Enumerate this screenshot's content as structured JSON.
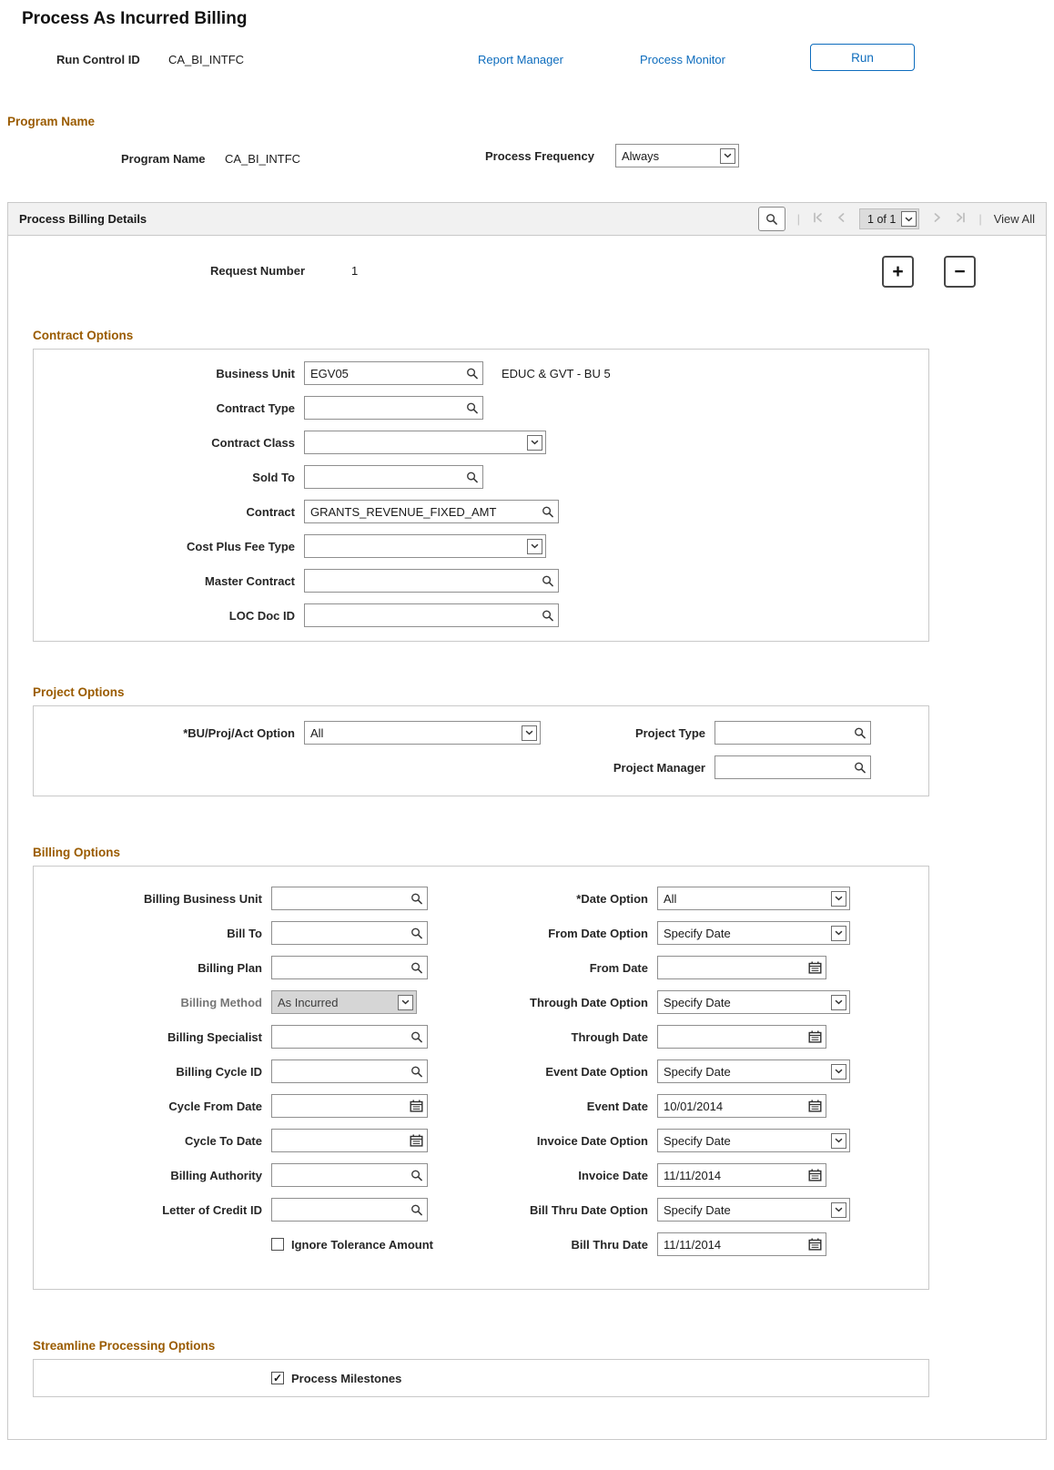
{
  "page_title": "Process As Incurred Billing",
  "toolbar": {
    "run_control_id_label": "Run Control ID",
    "run_control_id_value": "CA_BI_INTFC",
    "report_manager_link": "Report Manager",
    "process_monitor_link": "Process Monitor",
    "run_button_label": "Run"
  },
  "program_section": {
    "heading": "Program Name",
    "program_name_label": "Program Name",
    "program_name_value": "CA_BI_INTFC",
    "process_frequency_label": "Process Frequency",
    "process_frequency_value": "Always"
  },
  "process_billing_details": {
    "heading": "Process Billing Details",
    "row_counter": "1 of 1",
    "view_all_label": "View All",
    "request_number_label": "Request Number",
    "request_number_value": "1"
  },
  "icons": {
    "add_row": "+",
    "remove_row": "−"
  },
  "contract_options": {
    "heading": "Contract Options",
    "business_unit": {
      "label": "Business Unit",
      "value": "EGV05",
      "description": "EDUC & GVT - BU 5"
    },
    "contract_type": {
      "label": "Contract Type",
      "value": ""
    },
    "contract_class": {
      "label": "Contract Class",
      "value": ""
    },
    "sold_to": {
      "label": "Sold To",
      "value": ""
    },
    "contract": {
      "label": "Contract",
      "value": "GRANTS_REVENUE_FIXED_AMT"
    },
    "cost_plus_fee_type": {
      "label": "Cost Plus Fee Type",
      "value": ""
    },
    "master_contract": {
      "label": "Master Contract",
      "value": ""
    },
    "loc_doc_id": {
      "label": "LOC Doc ID",
      "value": ""
    }
  },
  "project_options": {
    "heading": "Project Options",
    "bu_proj_act_option": {
      "label": "*BU/Proj/Act Option",
      "value": "All"
    },
    "project_type": {
      "label": "Project Type",
      "value": ""
    },
    "project_manager": {
      "label": "Project Manager",
      "value": ""
    }
  },
  "billing_options": {
    "heading": "Billing Options",
    "billing_business_unit": {
      "label": "Billing Business Unit",
      "value": ""
    },
    "bill_to": {
      "label": "Bill To",
      "value": ""
    },
    "billing_plan": {
      "label": "Billing Plan",
      "value": ""
    },
    "billing_method": {
      "label": "Billing Method",
      "value": "As Incurred",
      "disabled": true
    },
    "billing_specialist": {
      "label": "Billing Specialist",
      "value": ""
    },
    "billing_cycle_id": {
      "label": "Billing Cycle ID",
      "value": ""
    },
    "cycle_from_date": {
      "label": "Cycle From Date",
      "value": ""
    },
    "cycle_to_date": {
      "label": "Cycle To Date",
      "value": ""
    },
    "billing_authority": {
      "label": "Billing Authority",
      "value": ""
    },
    "letter_of_credit_id": {
      "label": "Letter of Credit ID",
      "value": ""
    },
    "ignore_tolerance_amount": {
      "label": "Ignore Tolerance Amount",
      "checked": false
    },
    "date_option": {
      "label": "*Date Option",
      "value": "All"
    },
    "from_date_option": {
      "label": "From Date Option",
      "value": "Specify Date"
    },
    "from_date": {
      "label": "From Date",
      "value": ""
    },
    "through_date_option": {
      "label": "Through Date Option",
      "value": "Specify Date"
    },
    "through_date": {
      "label": "Through Date",
      "value": ""
    },
    "event_date_option": {
      "label": "Event Date Option",
      "value": "Specify Date"
    },
    "event_date": {
      "label": "Event Date",
      "value": "10/01/2014"
    },
    "invoice_date_option": {
      "label": "Invoice Date Option",
      "value": "Specify Date"
    },
    "invoice_date": {
      "label": "Invoice Date",
      "value": "11/11/2014"
    },
    "bill_thru_date_option": {
      "label": "Bill Thru Date Option",
      "value": "Specify Date"
    },
    "bill_thru_date": {
      "label": "Bill Thru Date",
      "value": "11/11/2014"
    }
  },
  "streamline_processing_options": {
    "heading": "Streamline Processing Options",
    "process_milestones": {
      "label": "Process Milestones",
      "checked": true
    }
  },
  "colors": {
    "heading_accent": "#9a5b00",
    "link_blue": "#0d6cbd",
    "section_header_bg": "#f1f1f1"
  }
}
